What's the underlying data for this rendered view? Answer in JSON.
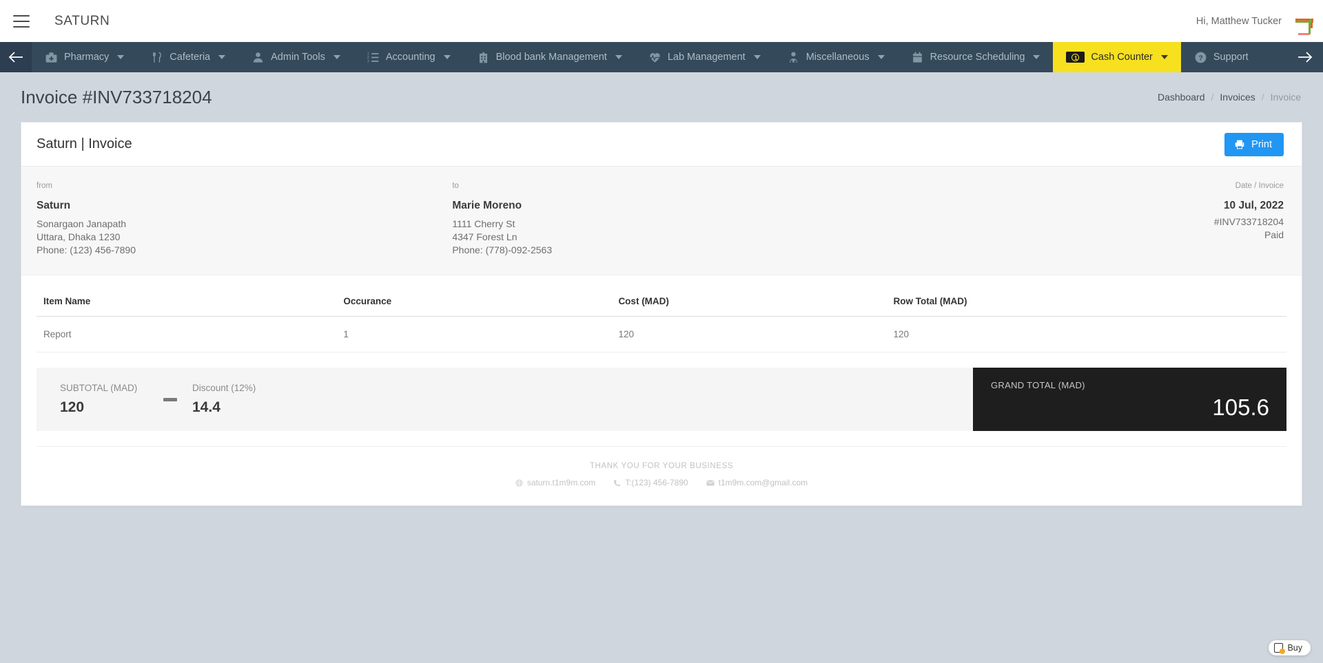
{
  "topbar": {
    "menu_icon": "hamburger-icon",
    "brand": "SATURN",
    "greeting": "Hi, Matthew Tucker"
  },
  "nav": {
    "back_icon": "arrow-left-icon",
    "forward_icon": "arrow-right-icon",
    "active_color": "#f7e01e",
    "bar_color": "#34495a",
    "items": [
      {
        "label": "Pharmacy",
        "icon": "medical-kit-icon",
        "has_caret": true,
        "active": false
      },
      {
        "label": "Cafeteria",
        "icon": "fork-knife-icon",
        "has_caret": true,
        "active": false
      },
      {
        "label": "Admin Tools",
        "icon": "user-icon",
        "has_caret": true,
        "active": false
      },
      {
        "label": "Accounting",
        "icon": "ordered-list-icon",
        "has_caret": true,
        "active": false
      },
      {
        "label": "Blood bank Management",
        "icon": "hospital-icon",
        "has_caret": true,
        "active": false
      },
      {
        "label": "Lab Management",
        "icon": "heartbeat-icon",
        "has_caret": true,
        "active": false
      },
      {
        "label": "Miscellaneous",
        "icon": "doctor-icon",
        "has_caret": true,
        "active": false
      },
      {
        "label": "Resource Scheduling",
        "icon": "calendar-icon",
        "has_caret": true,
        "active": false
      },
      {
        "label": "Cash Counter",
        "icon": "money-bill-icon",
        "has_caret": true,
        "active": true
      },
      {
        "label": "Support",
        "icon": "question-circle-icon",
        "has_caret": false,
        "active": false
      }
    ]
  },
  "page": {
    "title": "Invoice #INV733718204",
    "breadcrumb": [
      {
        "label": "Dashboard",
        "current": false
      },
      {
        "label": "Invoices",
        "current": false
      },
      {
        "label": "Invoice",
        "current": true
      }
    ],
    "breadcrumb_separator": "/"
  },
  "card": {
    "title": "Saturn | Invoice",
    "print_label": "Print",
    "print_icon": "printer-icon",
    "print_color": "#2196f3"
  },
  "from": {
    "label": "from",
    "name": "Saturn",
    "lines": [
      "Sonargaon Janapath",
      "Uttara, Dhaka 1230",
      "Phone: (123) 456-7890"
    ]
  },
  "to": {
    "label": "to",
    "name": "Marie Moreno",
    "lines": [
      "1111 Cherry St",
      "4347 Forest Ln",
      "Phone: (778)-092-2563"
    ]
  },
  "meta": {
    "label": "Date / Invoice",
    "date": "10 Jul, 2022",
    "invoice_number": "#INV733718204",
    "status": "Paid"
  },
  "table": {
    "headers": [
      "Item Name",
      "Occurance",
      "Cost (MAD)",
      "Row Total (MAD)"
    ],
    "rows": [
      {
        "item": "Report",
        "occurance": "1",
        "cost": "120",
        "row_total": "120"
      }
    ]
  },
  "totals": {
    "subtotal_label": "SUBTOTAL (MAD)",
    "subtotal_value": "120",
    "operator": "minus-sign",
    "discount_label": "Discount (12%)",
    "discount_value": "14.4",
    "grand_label": "GRAND TOTAL (MAD)",
    "grand_value": "105.6"
  },
  "footer": {
    "thanks": "THANK YOU FOR YOUR BUSINESS",
    "website": "saturn.t1m9m.com",
    "phone": "T:(123) 456-7890",
    "email": "t1m9m.com@gmail.com"
  },
  "widget": {
    "buy_label": "Buy"
  }
}
